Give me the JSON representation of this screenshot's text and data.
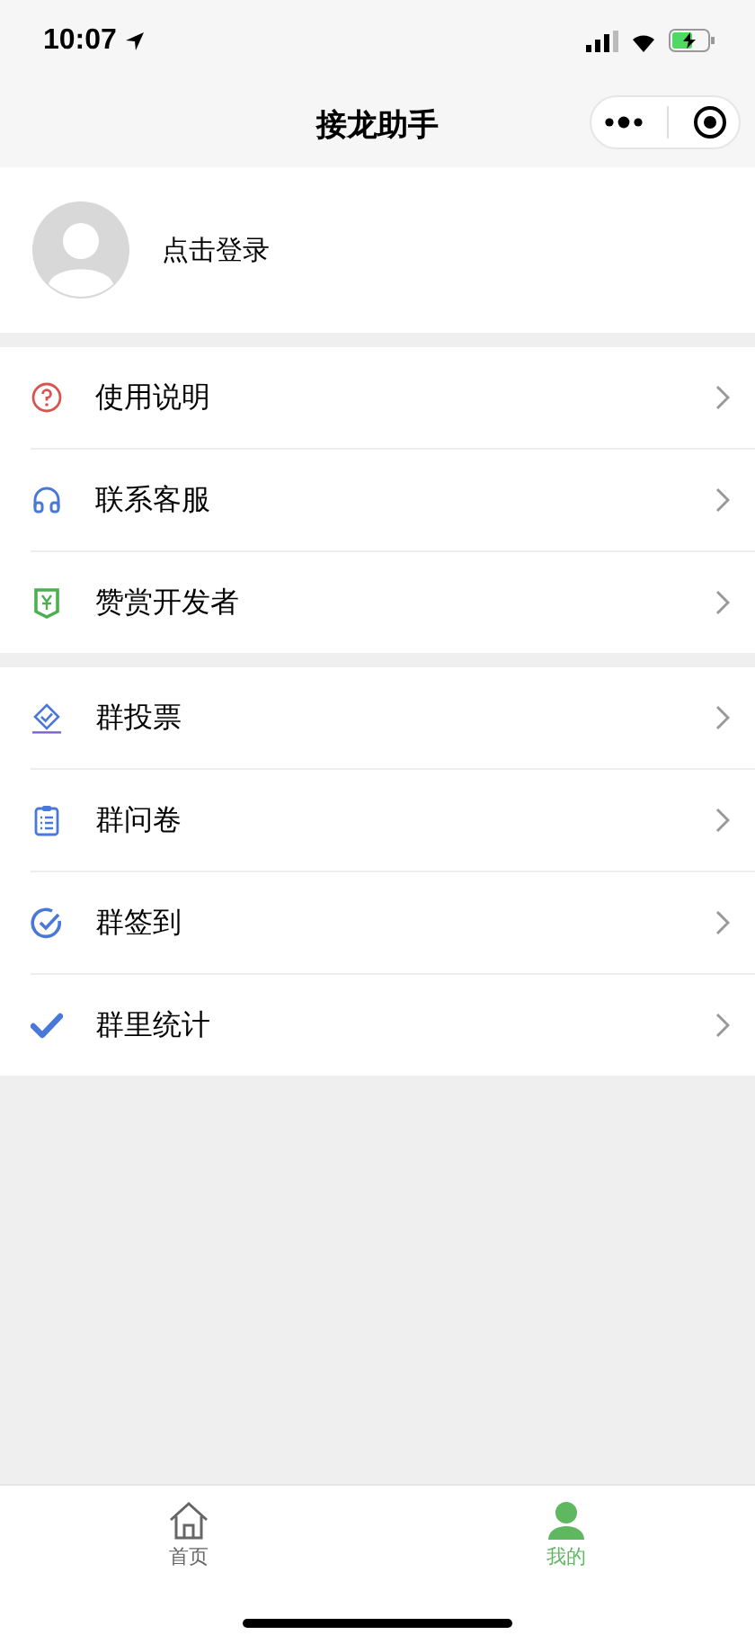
{
  "status_bar": {
    "time": "10:07"
  },
  "nav": {
    "title": "接龙助手"
  },
  "profile": {
    "login": "点击登录"
  },
  "groups": [
    {
      "items": [
        {
          "label": "使用说明",
          "kind": "help"
        },
        {
          "label": "联系客服",
          "kind": "headset"
        },
        {
          "label": "赞赏开发者",
          "kind": "reward"
        }
      ]
    },
    {
      "items": [
        {
          "label": "群投票",
          "kind": "vote"
        },
        {
          "label": "群问卷",
          "kind": "survey"
        },
        {
          "label": "群签到",
          "kind": "checkin"
        },
        {
          "label": "群里统计",
          "kind": "tick"
        }
      ]
    }
  ],
  "tab_bar": [
    {
      "label": "首页",
      "kind": "home",
      "selected": false
    },
    {
      "label": "我的",
      "kind": "person",
      "selected": true
    }
  ]
}
